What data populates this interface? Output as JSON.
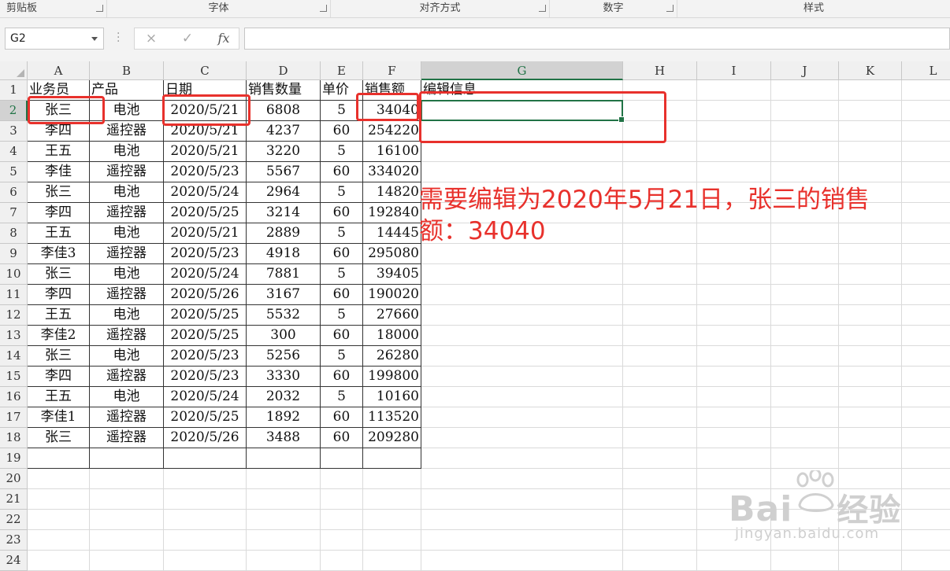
{
  "ribbon": {
    "groups": [
      "剪贴板",
      "字体",
      "对齐方式",
      "数字",
      "样式"
    ]
  },
  "formula_bar": {
    "name_box": "G2",
    "cancel_icon": "×",
    "enter_icon": "✓",
    "fx_label": "fx",
    "formula_value": ""
  },
  "sheet": {
    "columns": [
      "A",
      "B",
      "C",
      "D",
      "E",
      "F",
      "G",
      "H",
      "I",
      "J",
      "K",
      "L"
    ],
    "selected_column": "G",
    "selected_row": "2",
    "rows": [
      "1",
      "2",
      "3",
      "4",
      "5",
      "6",
      "7",
      "8",
      "9",
      "10",
      "11",
      "12",
      "13",
      "14",
      "15",
      "16",
      "17",
      "18",
      "19",
      "20",
      "21",
      "22",
      "23",
      "24"
    ],
    "header": [
      "业务员",
      "产品",
      "日期",
      "销售数量",
      "单价",
      "销售额",
      "编辑信息"
    ],
    "data": [
      [
        "张三",
        "电池",
        "2020/5/21",
        "6808",
        "5",
        "34040"
      ],
      [
        "李四",
        "遥控器",
        "2020/5/21",
        "4237",
        "60",
        "254220"
      ],
      [
        "王五",
        "电池",
        "2020/5/21",
        "3220",
        "5",
        "16100"
      ],
      [
        "李佳",
        "遥控器",
        "2020/5/23",
        "5567",
        "60",
        "334020"
      ],
      [
        "张三",
        "电池",
        "2020/5/24",
        "2964",
        "5",
        "14820"
      ],
      [
        "李四",
        "遥控器",
        "2020/5/25",
        "3214",
        "60",
        "192840"
      ],
      [
        "王五",
        "电池",
        "2020/5/21",
        "2889",
        "5",
        "14445"
      ],
      [
        "李佳3",
        "遥控器",
        "2020/5/23",
        "4918",
        "60",
        "295080"
      ],
      [
        "张三",
        "电池",
        "2020/5/24",
        "7881",
        "5",
        "39405"
      ],
      [
        "李四",
        "遥控器",
        "2020/5/26",
        "3167",
        "60",
        "190020"
      ],
      [
        "王五",
        "电池",
        "2020/5/25",
        "5532",
        "5",
        "27660"
      ],
      [
        "李佳2",
        "遥控器",
        "2020/5/25",
        "300",
        "60",
        "18000"
      ],
      [
        "张三",
        "电池",
        "2020/5/23",
        "5256",
        "5",
        "26280"
      ],
      [
        "李四",
        "遥控器",
        "2020/5/23",
        "3330",
        "60",
        "199800"
      ],
      [
        "王五",
        "电池",
        "2020/5/24",
        "2032",
        "5",
        "10160"
      ],
      [
        "李佳1",
        "遥控器",
        "2020/5/25",
        "1892",
        "60",
        "113520"
      ],
      [
        "张三",
        "遥控器",
        "2020/5/26",
        "3488",
        "60",
        "209280"
      ]
    ]
  },
  "annotation": {
    "line1": "需要编辑为2020年5月21日，张三的销售",
    "line2": "额：34040",
    "color": "#e8312c"
  },
  "watermark": {
    "brand": "Bai",
    "brand2": "经验",
    "url": "jingyan.baidu.com"
  }
}
